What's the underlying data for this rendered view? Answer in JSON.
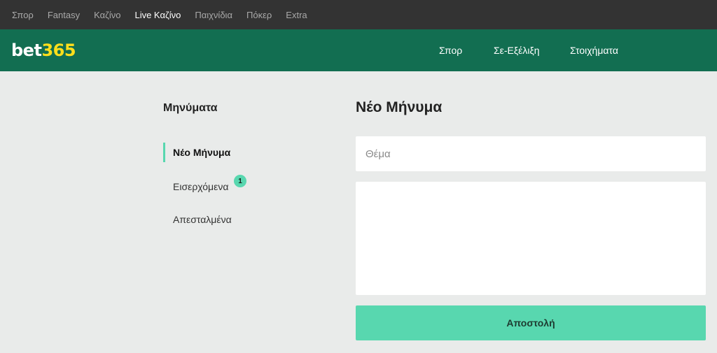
{
  "topbar": {
    "items": [
      {
        "label": "Σπορ",
        "active": false
      },
      {
        "label": "Fantasy",
        "active": false
      },
      {
        "label": "Καζίνο",
        "active": false
      },
      {
        "label": "Live Καζίνο",
        "active": true
      },
      {
        "label": "Παιχνίδια",
        "active": false
      },
      {
        "label": "Πόκερ",
        "active": false
      },
      {
        "label": "Extra",
        "active": false
      }
    ]
  },
  "header": {
    "logo": {
      "part1": "bet",
      "part2": "365"
    },
    "nav": [
      "Σπορ",
      "Σε-Εξέλιξη",
      "Στοιχήματα"
    ]
  },
  "sidebar": {
    "title": "Μηνύματα",
    "items": [
      {
        "label": "Νέο Μήνυμα",
        "active": true
      },
      {
        "label": "Εισερχόμενα",
        "badge": "1"
      },
      {
        "label": "Απεσταλμένα"
      }
    ]
  },
  "main": {
    "title": "Νέο Μήνυμα",
    "subject_placeholder": "Θέμα",
    "subject_value": "",
    "body_value": "",
    "send_label": "Αποστολή"
  },
  "colors": {
    "topbar_bg": "#333333",
    "header_bg": "#126e51",
    "accent": "#58d7af",
    "logo_yellow": "#ffdf1b",
    "page_bg": "#e9ebea"
  }
}
